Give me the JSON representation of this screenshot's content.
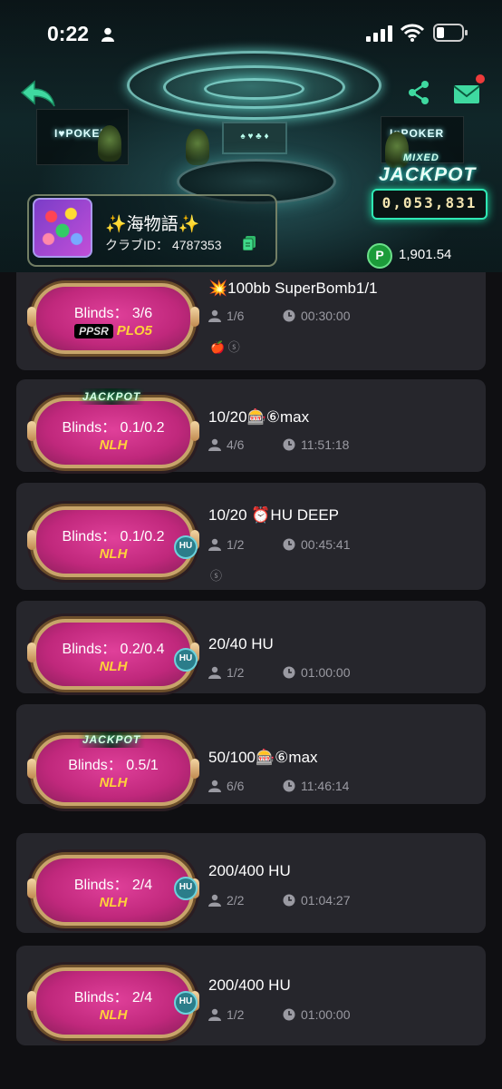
{
  "status_bar": {
    "time": "0:22"
  },
  "club": {
    "name": "✨海物語✨",
    "id_label": "クラブID：",
    "id_value": "4787353",
    "balance": "1,901.54",
    "balance_icon": "P"
  },
  "jackpot": {
    "top": "MIXED",
    "title": "JACKPOT",
    "value": "0,053,831"
  },
  "scene": {
    "neon_left": "I♥POKER",
    "neon_right": "I♥POKER",
    "tv": "♠ ♥ ♣ ♦"
  },
  "tables": [
    {
      "blinds": "Blinds：  3/6",
      "game": "PLO5",
      "game_prefix": "PPSR",
      "title": "💥100bb SuperBomb1/1",
      "players": "1/6",
      "time": "00:30:00",
      "jackpot": false,
      "hu": false,
      "tags": "🍎 ⓢ"
    },
    {
      "blinds": "Blinds：  0.1/0.2",
      "game": "NLH",
      "title": "10/20🎰⑥max",
      "players": "4/6",
      "time": "11:51:18",
      "jackpot": true,
      "jackpot_label": "JACKPOT",
      "hu": false
    },
    {
      "blinds": "Blinds：  0.1/0.2",
      "game": "NLH",
      "title": "10/20 ⏰HU DEEP",
      "players": "1/2",
      "time": "00:45:41",
      "jackpot": false,
      "hu": true,
      "hu_label": "HU",
      "tags": "ⓢ"
    },
    {
      "blinds": "Blinds：  0.2/0.4",
      "game": "NLH",
      "title": "20/40 HU",
      "players": "1/2",
      "time": "01:00:00",
      "jackpot": false,
      "hu": true,
      "hu_label": "HU"
    },
    {
      "blinds": "Blinds：  0.5/1",
      "game": "NLH",
      "title": "50/100🎰⑥max",
      "players": "6/6",
      "time": "11:46:14",
      "jackpot": true,
      "jackpot_label": "JACKPOT",
      "hu": false
    },
    {
      "blinds": "Blinds：  2/4",
      "game": "NLH",
      "title": "200/400 HU",
      "players": "2/2",
      "time": "01:04:27",
      "jackpot": false,
      "hu": true,
      "hu_label": "HU"
    },
    {
      "blinds": "Blinds：  2/4",
      "game": "NLH",
      "title": "200/400 HU",
      "players": "1/2",
      "time": "01:00:00",
      "jackpot": false,
      "hu": true,
      "hu_label": "HU"
    }
  ],
  "colors": {
    "accent_green": "#2fe8b4",
    "badge_pink": "#d8358f",
    "gold": "#ffd23a",
    "card_bg": "#26262c"
  }
}
